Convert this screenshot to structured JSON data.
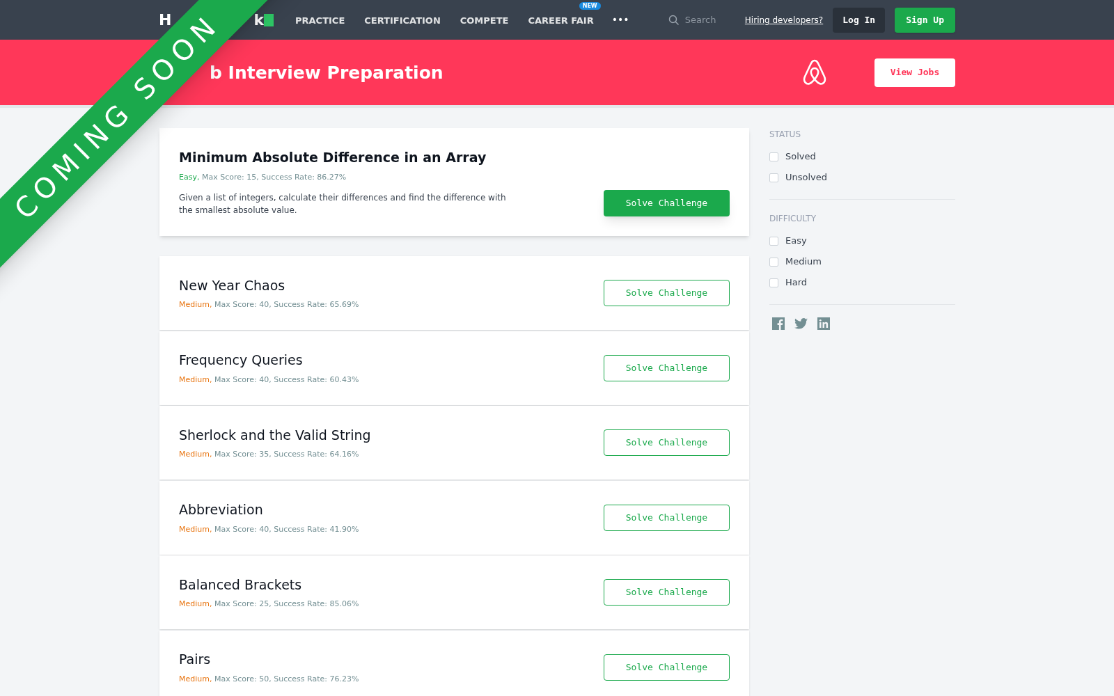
{
  "nav": {
    "logo_start": "H",
    "logo_end": "k",
    "links": [
      {
        "label": "PRACTICE"
      },
      {
        "label": "CERTIFICATION"
      },
      {
        "label": "COMPETE"
      },
      {
        "label": "CAREER FAIR",
        "badge": "NEW"
      }
    ],
    "more": "•••",
    "search": {
      "placeholder": "Search"
    },
    "hiring_link": "Hiring developers?",
    "login": "Log In",
    "signup": "Sign Up"
  },
  "banner": {
    "title": "b Interview Preparation",
    "button": "View Jobs"
  },
  "ribbon": "COMING SOON",
  "challenges": [
    {
      "kind": "featured",
      "title": "Minimum Absolute Difference in an Array",
      "difficulty": "Easy,",
      "color": "#1ba94c",
      "details": "Max Score: 15, Success Rate: 86.27%",
      "description": "Given a list of integers, calculate their differences and find the difference with the smallest absolute value.",
      "button": "Solve Challenge"
    },
    {
      "kind": "regular",
      "title": "New Year Chaos",
      "difficulty": "Medium,",
      "color": "#e87613",
      "details": "Max Score: 40, Success Rate: 65.69%",
      "button": "Solve Challenge"
    },
    {
      "kind": "regular",
      "title": "Frequency Queries",
      "difficulty": "Medium,",
      "color": "#e87613",
      "details": "Max Score: 40, Success Rate: 60.43%",
      "button": "Solve Challenge"
    },
    {
      "kind": "regular",
      "title": "Sherlock and the Valid String",
      "difficulty": "Medium,",
      "color": "#e87613",
      "details": "Max Score: 35, Success Rate: 64.16%",
      "button": "Solve Challenge"
    },
    {
      "kind": "regular",
      "title": "Abbreviation",
      "difficulty": "Medium,",
      "color": "#e87613",
      "details": "Max Score: 40, Success Rate: 41.90%",
      "button": "Solve Challenge"
    },
    {
      "kind": "regular",
      "title": "Balanced Brackets",
      "difficulty": "Medium,",
      "color": "#e87613",
      "details": "Max Score: 25, Success Rate: 85.06%",
      "button": "Solve Challenge"
    },
    {
      "kind": "regular",
      "title": "Pairs",
      "difficulty": "Medium,",
      "color": "#e87613",
      "details": "Max Score: 50, Success Rate: 76.23%",
      "button": "Solve Challenge"
    }
  ],
  "filters": [
    {
      "heading": "STATUS",
      "options": [
        {
          "label": "Solved",
          "checked": false
        },
        {
          "label": "Unsolved",
          "checked": false
        }
      ]
    },
    {
      "heading": "DIFFICULTY",
      "options": [
        {
          "label": "Easy",
          "checked": false
        },
        {
          "label": "Medium",
          "checked": false
        },
        {
          "label": "Hard",
          "checked": false
        }
      ]
    }
  ]
}
